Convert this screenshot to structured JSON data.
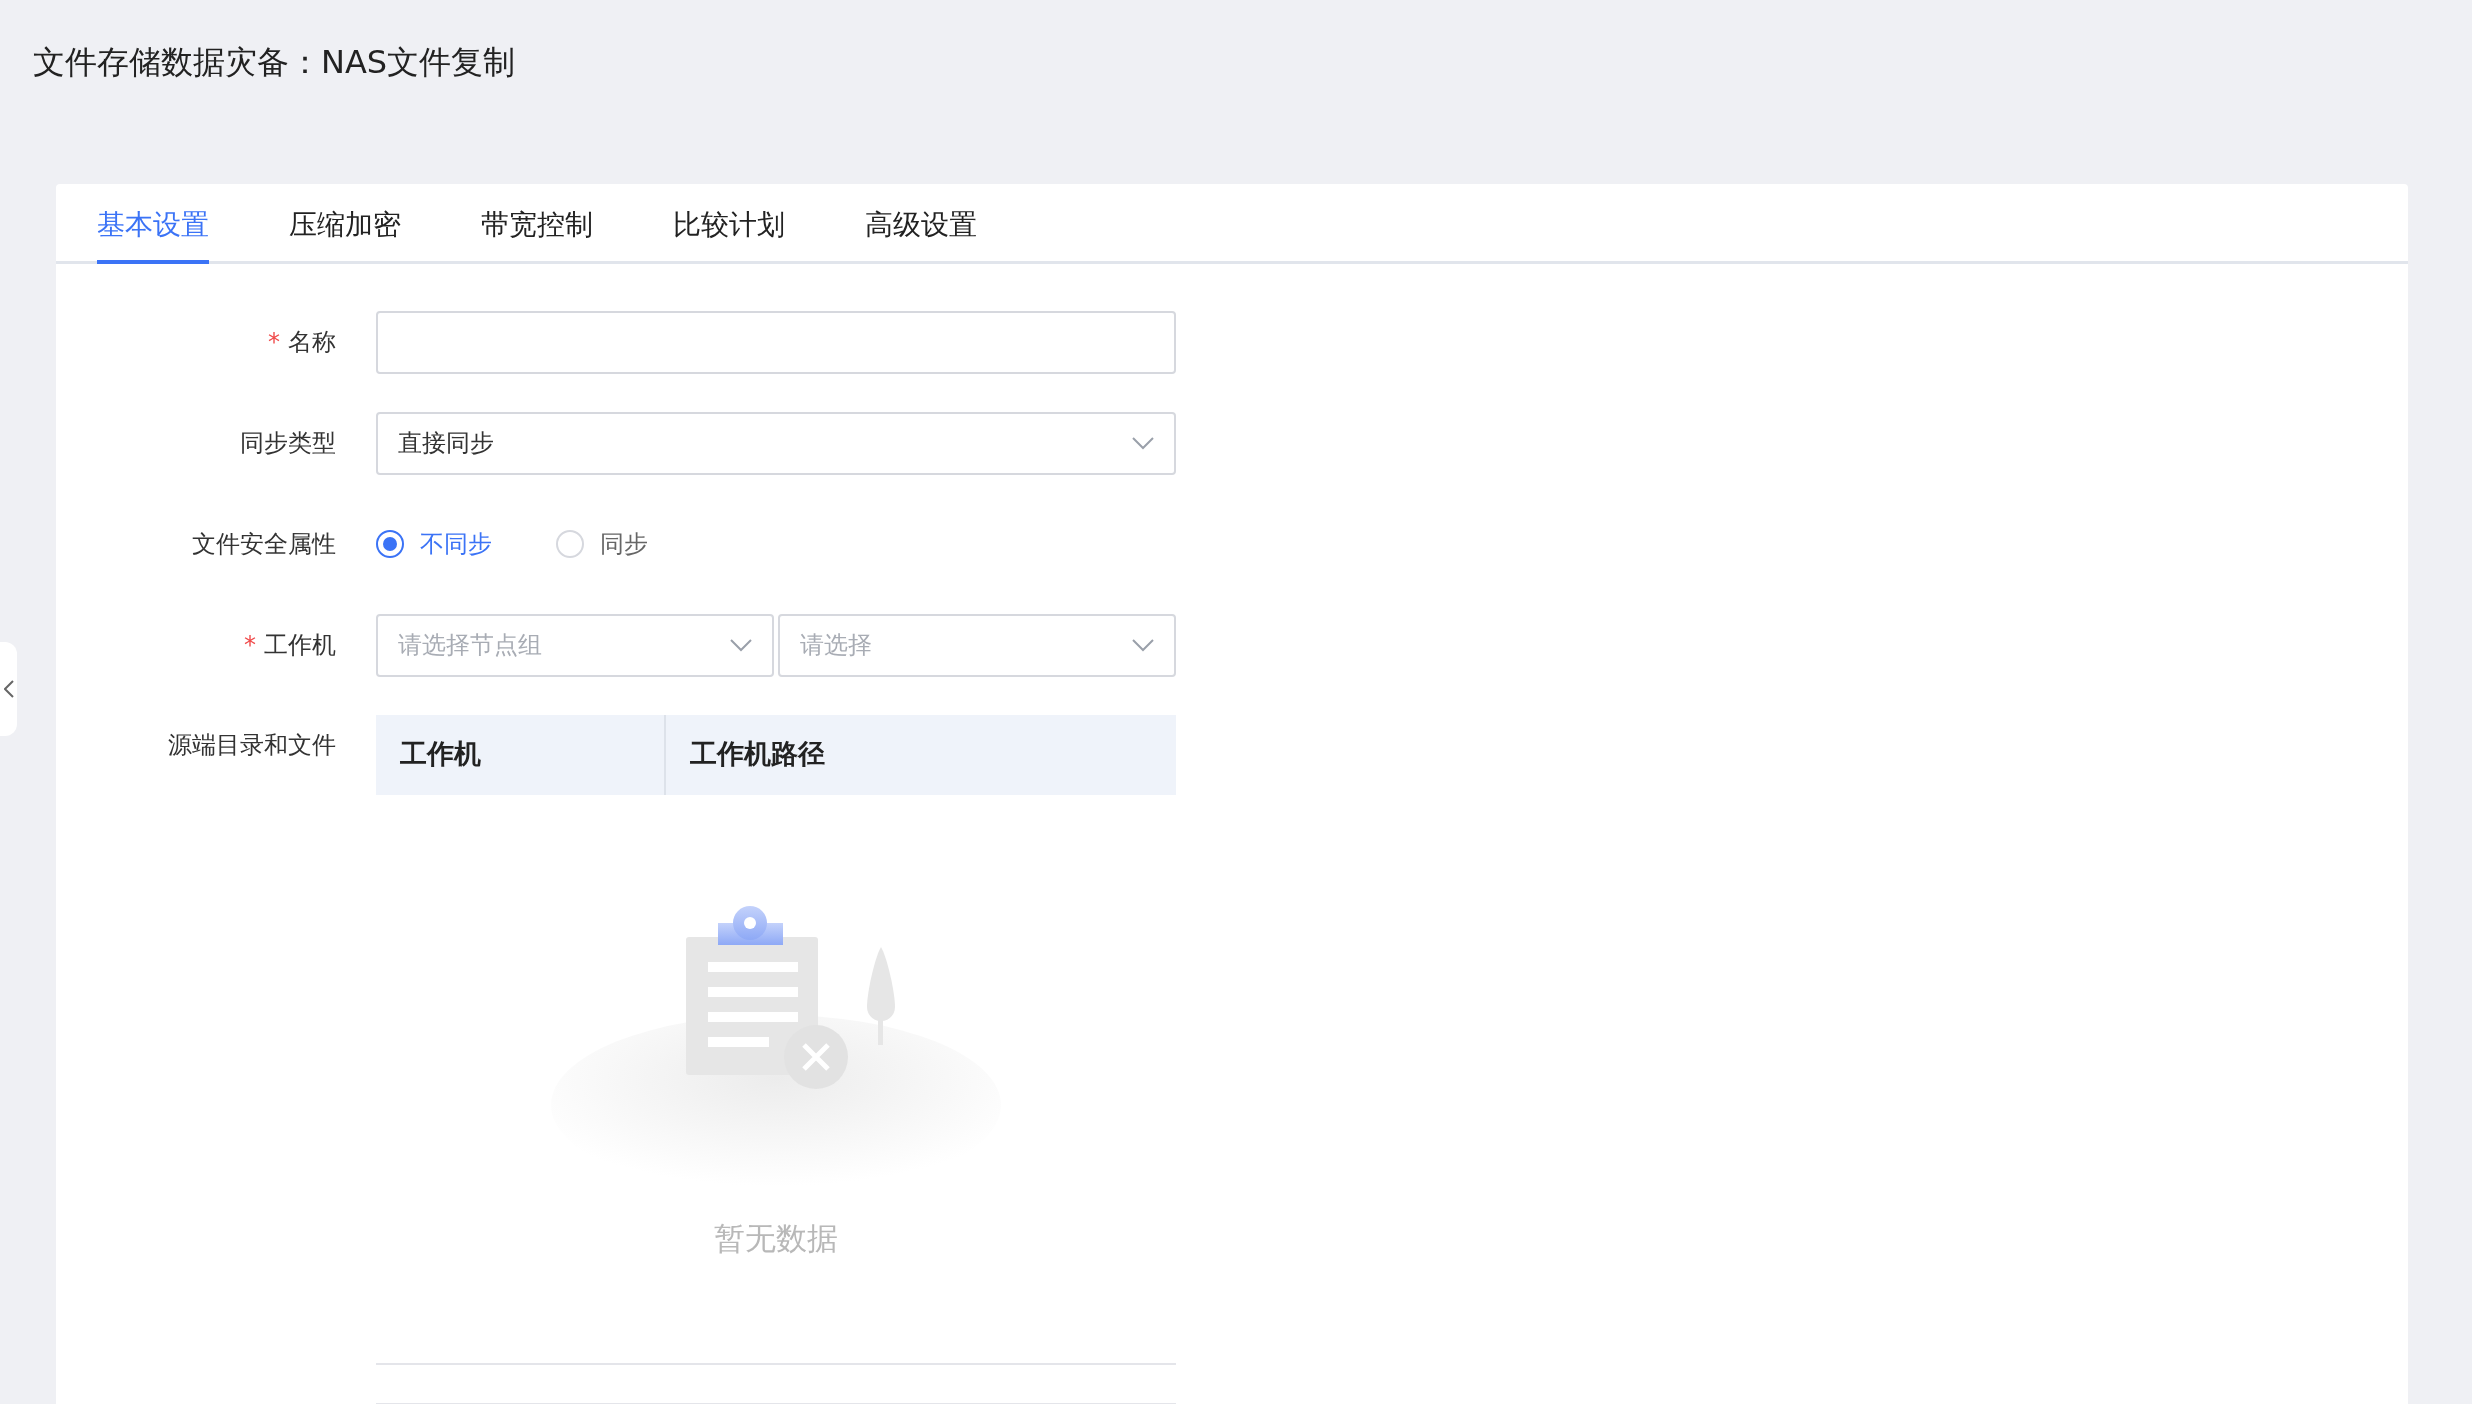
{
  "page": {
    "title": "文件存储数据灾备：NAS文件复制"
  },
  "tabs": [
    {
      "label": "基本设置",
      "selected": true
    },
    {
      "label": "压缩加密",
      "selected": false
    },
    {
      "label": "带宽控制",
      "selected": false
    },
    {
      "label": "比较计划",
      "selected": false
    },
    {
      "label": "高级设置",
      "selected": false
    }
  ],
  "form": {
    "fields": [
      {
        "kind": "text",
        "label": "名称",
        "required_mark": "*"
      },
      {
        "kind": "select",
        "label": "同步类型",
        "value": "直接同步"
      },
      {
        "kind": "radio",
        "label": "文件安全属性",
        "options": [
          {
            "label": "不同步",
            "selected": true
          },
          {
            "label": "同步",
            "selected": false
          }
        ]
      },
      {
        "kind": "select_pair",
        "label": "工作机",
        "required_mark": "*",
        "selects": [
          {
            "placeholder": "请选择节点组"
          },
          {
            "placeholder": "请选择"
          }
        ]
      },
      {
        "kind": "table",
        "label": "源端目录和文件",
        "columns": [
          "工作机",
          "工作机路径"
        ],
        "empty_text": "暂无数据"
      }
    ]
  }
}
